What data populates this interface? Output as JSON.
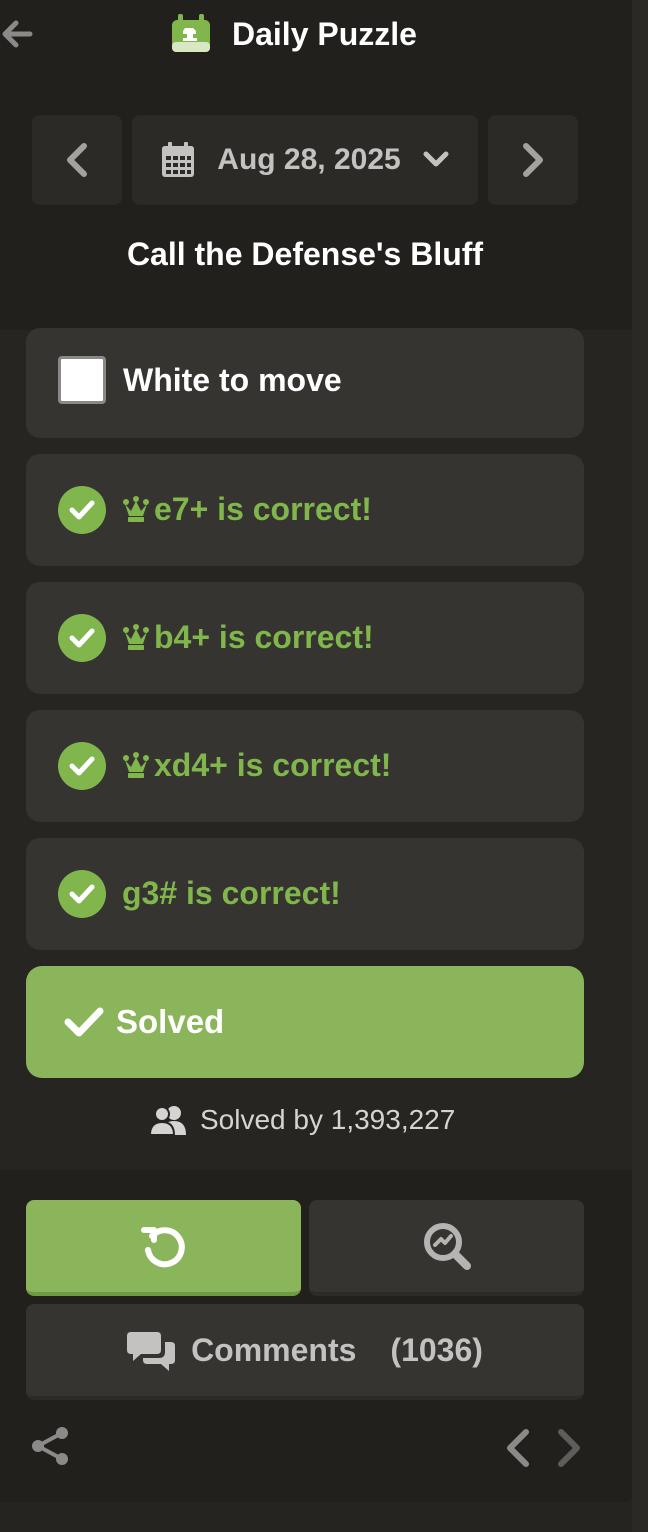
{
  "header": {
    "title": "Daily Puzzle",
    "back_icon": "arrow-left-icon",
    "logo_icon": "daily-puzzle-calendar-icon"
  },
  "date_nav": {
    "date": "Aug 28, 2025",
    "prev_icon": "chevron-left-icon",
    "next_icon": "chevron-right-icon",
    "calendar_icon": "calendar-icon",
    "dropdown_icon": "chevron-down-icon"
  },
  "puzzle": {
    "title": "Call the Defense's Bluff",
    "to_move": "White to move",
    "moves": [
      {
        "piece_icon": "queen-icon",
        "text": "e7+ is correct!"
      },
      {
        "piece_icon": "queen-icon",
        "text": "b4+ is correct!"
      },
      {
        "piece_icon": "queen-icon",
        "text": "xd4+ is correct!"
      },
      {
        "piece_icon": "",
        "text": "g3# is correct!"
      }
    ],
    "status": "Solved",
    "solved_by_label": "Solved by 1,393,227"
  },
  "actions": {
    "retry_icon": "retry-icon",
    "analysis_icon": "magnify-analysis-icon",
    "comments_label": "Comments",
    "comments_count": "(1036)"
  },
  "colors": {
    "accent_green": "#81b64c",
    "solved_bg": "#8bb55a",
    "card_bg": "#363431",
    "panel_bg": "#21201d"
  }
}
